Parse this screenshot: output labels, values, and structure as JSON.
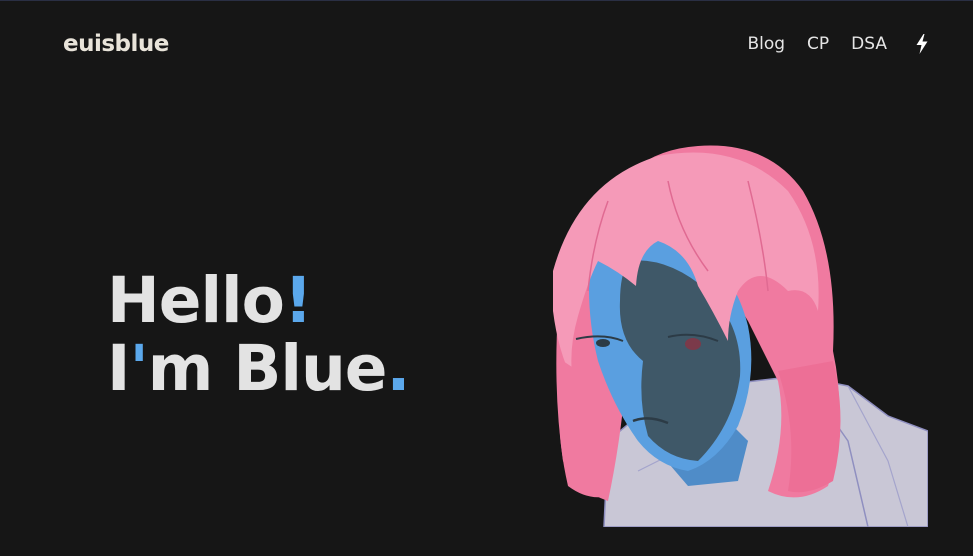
{
  "header": {
    "logo": "euisblue",
    "nav": [
      {
        "label": "Blog"
      },
      {
        "label": "CP"
      },
      {
        "label": "DSA"
      }
    ],
    "theme_toggle_icon": "lightning-bolt-icon"
  },
  "hero": {
    "line1": "Hello",
    "line1_mark": "!",
    "line2_part1": "I",
    "line2_apostrophe": "'",
    "line2_part2": "m Blue",
    "line2_mark": "."
  },
  "colors": {
    "background": "#161616",
    "accent": "#5ba8ec",
    "text": "#e3e3e3",
    "logo": "#e9e4da"
  },
  "illustration": "portrait-illustration"
}
